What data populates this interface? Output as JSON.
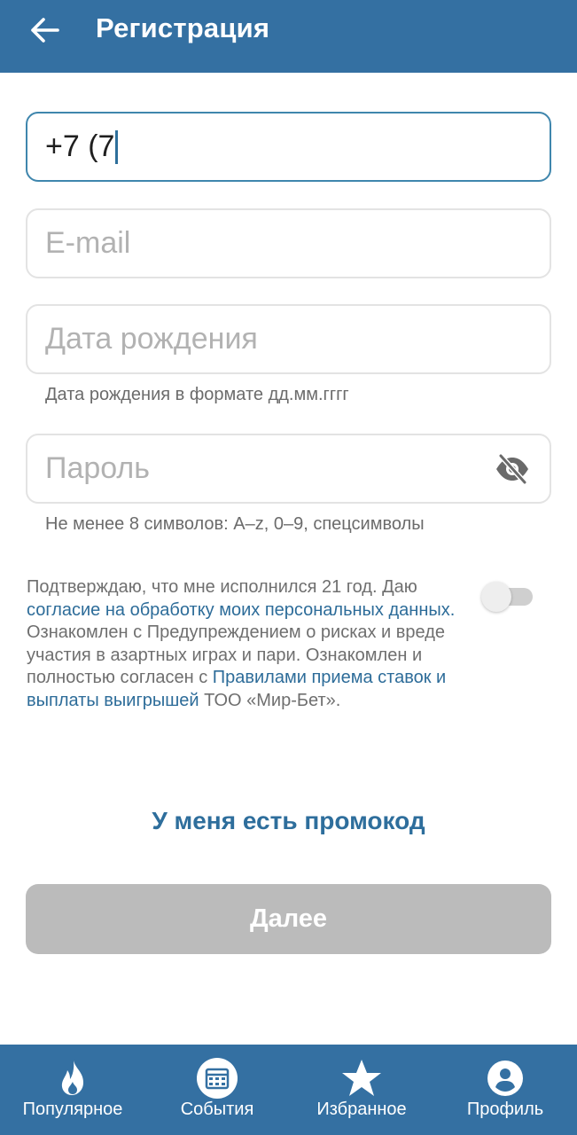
{
  "header": {
    "title": "Регистрация",
    "back_icon": "arrow-left-icon"
  },
  "form": {
    "phone": {
      "value": "+7 (7",
      "state": "focused"
    },
    "email": {
      "placeholder": "E-mail"
    },
    "birthdate": {
      "placeholder": "Дата рождения",
      "hint": "Дата рождения в формате дд.мм.гггг"
    },
    "password": {
      "placeholder": "Пароль",
      "hint": "Не менее 8 символов: A–z, 0–9, спецсимволы",
      "visibility_icon": "eye-off-icon"
    }
  },
  "consent": {
    "text_1": "Подтверждаю, что мне исполнился 21 год. Даю ",
    "link_1": "согласие на обработку моих персональных данных.",
    "text_2": " Ознакомлен с Предупреждением о рисках и вреде участия в азартных играх и пари. Ознакомлен и полностью согласен с ",
    "link_2": "Правилами приема ставок и выплаты выигрышей",
    "text_3": " ТОО «Мир-Бет».",
    "toggle_on": false
  },
  "promo_label": "У меня есть промокод",
  "next_label": "Далее",
  "nav": [
    {
      "label": "Популярное",
      "icon": "flame-icon"
    },
    {
      "label": "События",
      "icon": "calendar-icon"
    },
    {
      "label": "Избранное",
      "icon": "star-icon"
    },
    {
      "label": "Профиль",
      "icon": "user-icon"
    }
  ],
  "colors": {
    "primary": "#3470a2",
    "link": "#2d6c99",
    "disabled_button": "#bbbbbb",
    "focus_border": "#3f86ad"
  }
}
